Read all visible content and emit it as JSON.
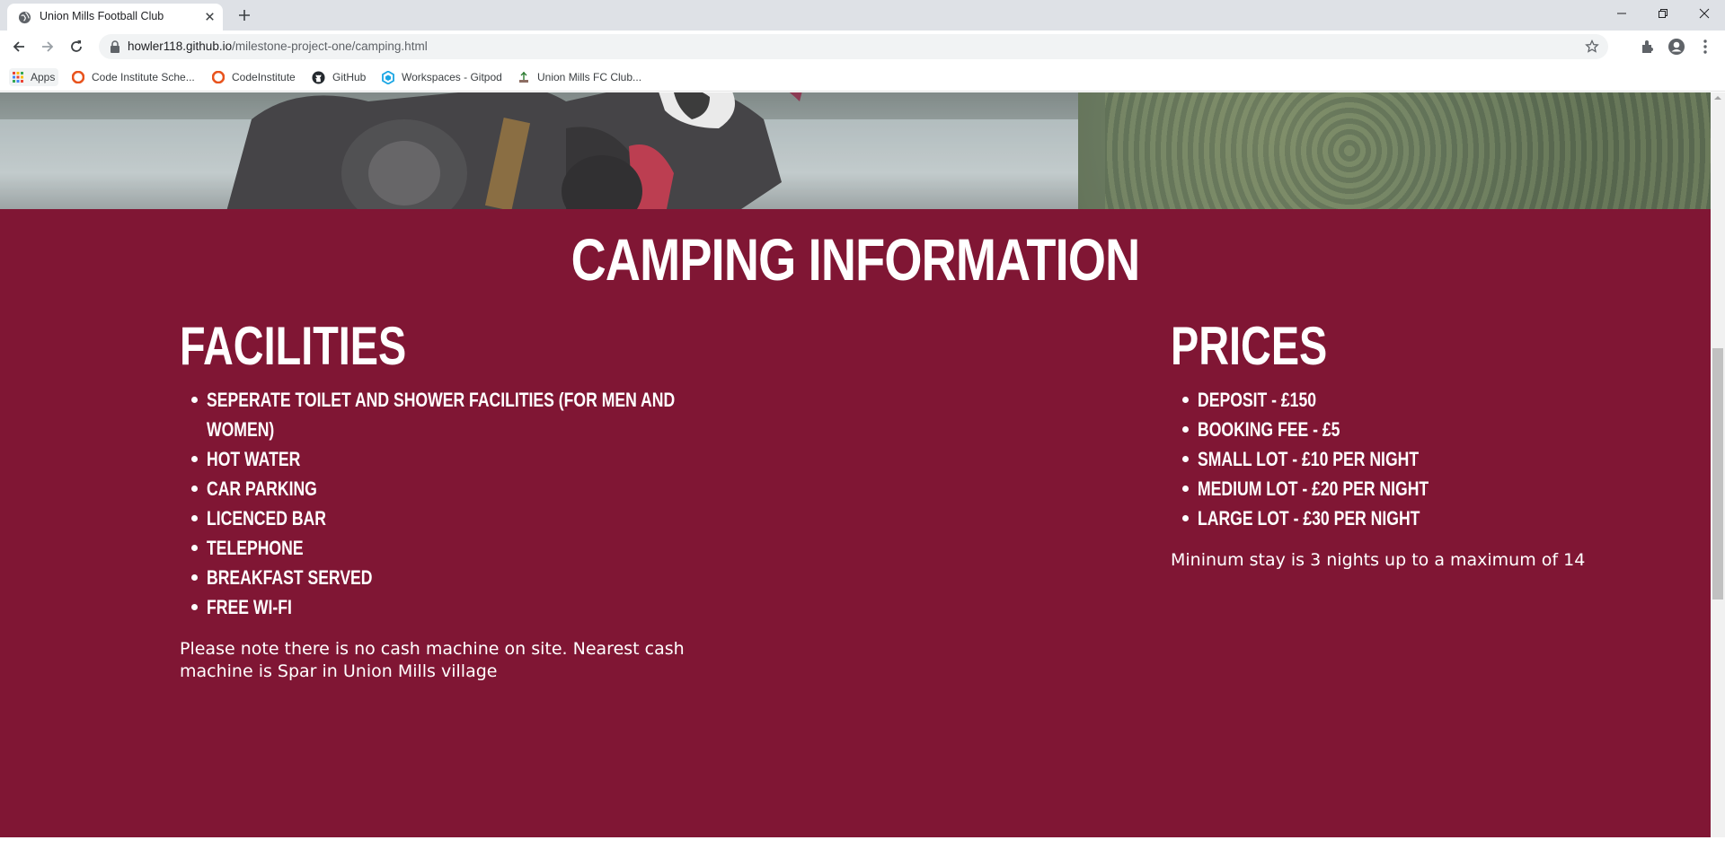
{
  "browser": {
    "tab": {
      "title": "Union Mills Football Club"
    },
    "address": {
      "host": "howler118.github.io",
      "path": "/milestone-project-one/camping.html"
    },
    "bookmarks": [
      {
        "label": "Apps"
      },
      {
        "label": "Code Institute Sche..."
      },
      {
        "label": "CodeInstitute"
      },
      {
        "label": "GitHub"
      },
      {
        "label": "Workspaces - Gitpod"
      },
      {
        "label": "Union Mills FC Club..."
      }
    ]
  },
  "page": {
    "section_title": "CAMPING INFORMATION",
    "facilities": {
      "title": "FACILITIES",
      "items": [
        "SEPERATE TOILET AND SHOWER FACILITIES (FOR MEN AND WOMEN)",
        "HOT WATER",
        "CAR PARKING",
        "LICENCED BAR",
        "TELEPHONE",
        "BREAKFAST SERVED",
        "FREE WI-FI"
      ],
      "note": "Please note there is no cash machine on site. Nearest cash machine is Spar in Union Mills village"
    },
    "prices": {
      "title": "PRICES",
      "items": [
        "DEPOSIT - £150",
        "BOOKING FEE - £5",
        "SMALL LOT - £10 PER NIGHT",
        "MEDIUM LOT - £20 PER NIGHT",
        "LARGE LOT - £30 PER NIGHT"
      ],
      "note": "Mininum stay is 3 nights up to a maximum of 14"
    }
  },
  "colors": {
    "brand": "#801634",
    "text": "#ffffff"
  }
}
